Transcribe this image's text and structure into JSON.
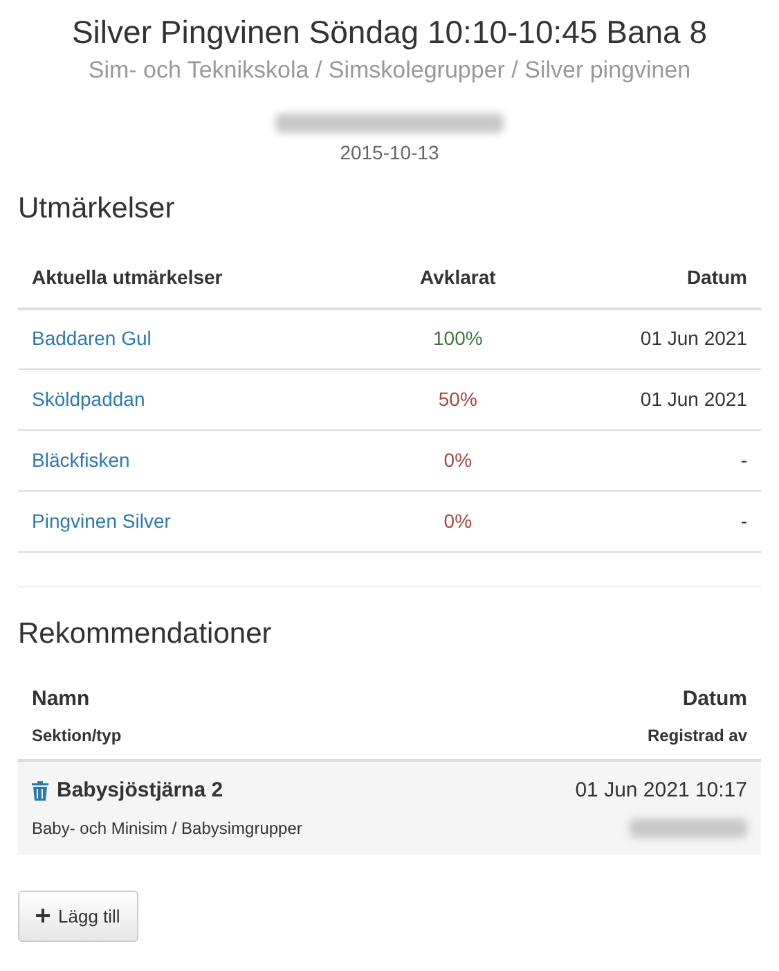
{
  "header": {
    "title": "Silver Pingvinen Söndag 10:10-10:45 Bana 8",
    "breadcrumb": "Sim- och Teknikskola / Simskolegrupper / Silver pingvinen",
    "date": "2015-10-13"
  },
  "awards": {
    "heading": "Utmärkelser",
    "columns": [
      "Aktuella utmärkelser",
      "Avklarat",
      "Datum"
    ],
    "rows": [
      {
        "name": "Baddaren Gul",
        "progress": "100%",
        "done": true,
        "date": "01 Jun 2021"
      },
      {
        "name": "Sköldpaddan",
        "progress": "50%",
        "done": false,
        "date": "01 Jun 2021"
      },
      {
        "name": "Bläckfisken",
        "progress": "0%",
        "done": false,
        "date": "-"
      },
      {
        "name": "Pingvinen Silver",
        "progress": "0%",
        "done": false,
        "date": "-"
      }
    ]
  },
  "recommendations": {
    "heading": "Rekommendationer",
    "columns": [
      "Namn",
      "Datum"
    ],
    "subcolumns": [
      "Sektion/typ",
      "Registrad av"
    ],
    "rows": [
      {
        "name": "Babysjöstjärna 2",
        "section": "Baby- och Minisim / Babysimgrupper",
        "date": "01 Jun 2021 10:17"
      }
    ]
  },
  "add_button": "Lägg till"
}
